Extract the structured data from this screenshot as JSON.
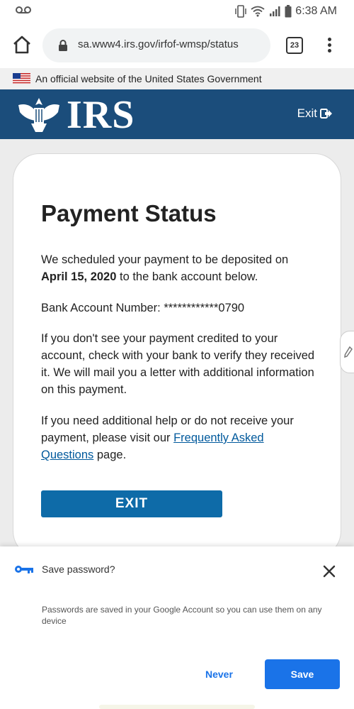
{
  "status_bar": {
    "time": "6:38 AM",
    "icons": [
      "voicemail-icon",
      "vibrate-icon",
      "wifi-icon",
      "signal-icon",
      "battery-icon"
    ]
  },
  "browser": {
    "url": "sa.www4.irs.gov/irfof-wmsp/status",
    "tab_count": "23"
  },
  "gov_banner": {
    "text": "An official website of the United States Government"
  },
  "header": {
    "logo_text": "IRS",
    "exit_label": "Exit",
    "colors": {
      "header_bg": "#1b4d7b"
    }
  },
  "page": {
    "title": "Payment Status",
    "p1_before": "We scheduled your payment to be deposited on ",
    "p1_date": "April 15, 2020",
    "p1_after": " to the bank account below.",
    "account_label": "Bank Account Number: ",
    "account_value": "************0790",
    "p3": "If you don't see your payment credited to your account, check with your bank to verify they received it. We will mail you a letter with additional information on this payment.",
    "p4_before": "If you need additional help or do not receive your payment, please visit our ",
    "faq_link": "Frequently Asked Questions",
    "p4_after": " page.",
    "exit_button": "EXIT",
    "colors": {
      "button": "#0e6ba8",
      "link": "#00599c"
    }
  },
  "save_password": {
    "title": "Save password?",
    "description": "Passwords are saved in your Google Account so you can use them on any device",
    "never_label": "Never",
    "save_label": "Save",
    "colors": {
      "accent": "#1a73e8"
    }
  }
}
